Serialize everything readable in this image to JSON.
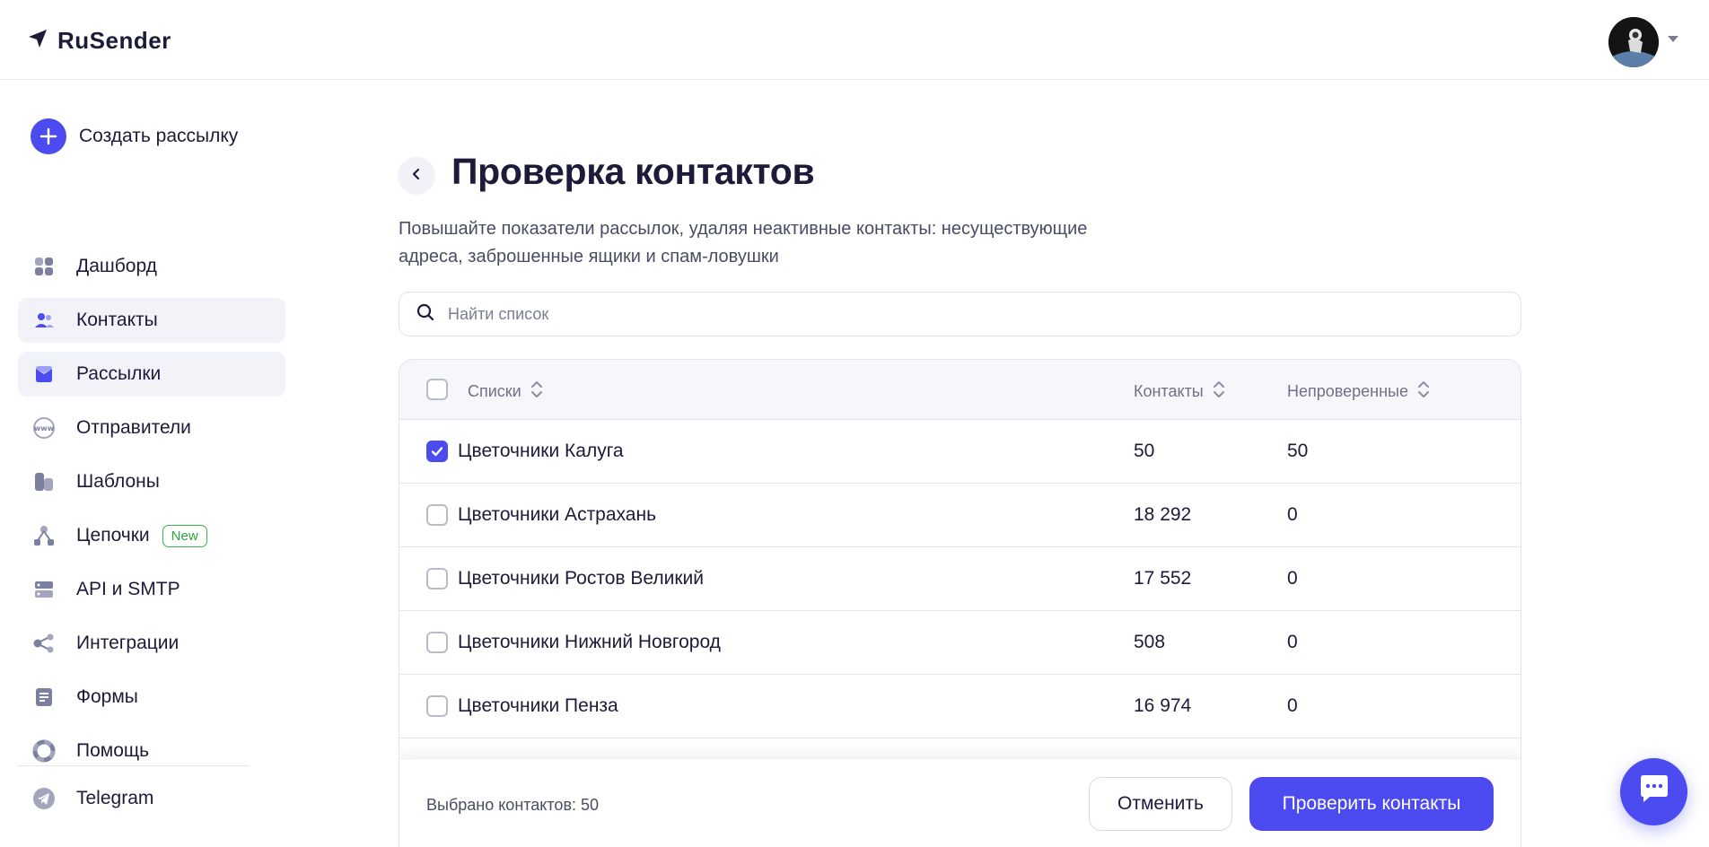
{
  "app": {
    "logo_text": "RuSender",
    "accent": "#4b4bf0"
  },
  "header": {
    "avatar_icon": "user-avatar",
    "caret_icon": "caret-down-icon"
  },
  "sidebar": {
    "create_label": "Создать рассылку",
    "items": [
      {
        "label": "Дашборд",
        "icon": "dashboard-icon"
      },
      {
        "label": "Контакты",
        "icon": "contacts-icon",
        "active": true
      },
      {
        "label": "Рассылки",
        "icon": "mailings-icon",
        "active": true
      },
      {
        "label": "Отправители",
        "icon": "www-icon"
      },
      {
        "label": "Шаблоны",
        "icon": "templates-icon"
      },
      {
        "label": "Цепочки",
        "icon": "chains-icon",
        "badge": "New"
      },
      {
        "label": "API и SMTP",
        "icon": "server-icon"
      },
      {
        "label": "Интеграции",
        "icon": "integrations-icon"
      },
      {
        "label": "Формы",
        "icon": "forms-icon"
      },
      {
        "label": "Помощь",
        "icon": "help-icon"
      }
    ],
    "telegram_label": "Telegram"
  },
  "main": {
    "title": "Проверка контактов",
    "description_line1": "Повышайте показатели рассылок, удаляя неактивные контакты: несуществующие",
    "description_line2": "адреса, заброшенные ящики и спам-ловушки",
    "search_placeholder": "Найти список"
  },
  "table": {
    "headers": {
      "lists": "Списки",
      "contacts": "Контакты",
      "unverified": "Непроверенные"
    },
    "rows": [
      {
        "name": "Цветочники Калуга",
        "contacts": "50",
        "unverified": "50",
        "checked": true
      },
      {
        "name": "Цветочники Астрахань",
        "contacts": "18 292",
        "unverified": "0",
        "checked": false
      },
      {
        "name": "Цветочники Ростов Великий",
        "contacts": "17 552",
        "unverified": "0",
        "checked": false
      },
      {
        "name": "Цветочники Нижний Новгород",
        "contacts": "508",
        "unverified": "0",
        "checked": false
      },
      {
        "name": "Цветочники Пенза",
        "contacts": "16 974",
        "unverified": "0",
        "checked": false
      }
    ]
  },
  "footer": {
    "selected_text": "Выбрано контактов: 50",
    "cancel_label": "Отменить",
    "check_label": "Проверить контакты"
  }
}
